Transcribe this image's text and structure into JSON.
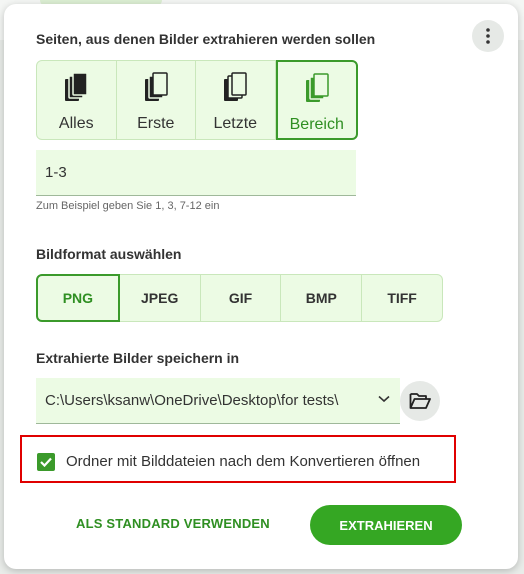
{
  "pages": {
    "title": "Seiten, aus denen Bilder extrahieren werden sollen",
    "options": [
      {
        "label": "Alles",
        "icon": "all-pages-icon",
        "active": false
      },
      {
        "label": "Erste",
        "icon": "first-page-icon",
        "active": false
      },
      {
        "label": "Letzte",
        "icon": "last-page-icon",
        "active": false
      },
      {
        "label": "Bereich",
        "icon": "range-pages-icon",
        "active": true
      }
    ],
    "range_value": "1-3",
    "hint": "Zum Beispiel geben Sie 1, 3, 7-12 ein"
  },
  "format": {
    "title": "Bildformat auswählen",
    "options": [
      {
        "label": "PNG",
        "active": true
      },
      {
        "label": "JPEG",
        "active": false
      },
      {
        "label": "GIF",
        "active": false
      },
      {
        "label": "BMP",
        "active": false
      },
      {
        "label": "TIFF",
        "active": false
      }
    ]
  },
  "save": {
    "title": "Extrahierte Bilder speichern in",
    "path": "C:\\Users\\ksanw\\OneDrive\\Desktop\\for tests\\"
  },
  "open_folder": {
    "label": "Ordner mit Bilddateien nach dem Konvertieren öffnen",
    "checked": true
  },
  "actions": {
    "default_label": "ALS STANDARD VERWENDEN",
    "extract_label": "EXTRAHIEREN"
  },
  "colors": {
    "accent": "#35a723",
    "option_bg": "#ecfbe4",
    "highlight": "#e00000"
  }
}
